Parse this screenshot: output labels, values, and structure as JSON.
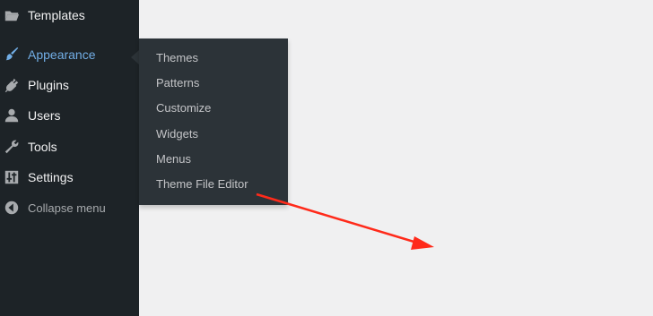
{
  "sidebar": {
    "items": [
      {
        "label": "Templates",
        "icon": "folder-icon"
      },
      {
        "label": "Appearance",
        "icon": "paintbrush-icon",
        "active": true
      },
      {
        "label": "Plugins",
        "icon": "plug-icon"
      },
      {
        "label": "Users",
        "icon": "user-icon"
      },
      {
        "label": "Tools",
        "icon": "wrench-icon"
      },
      {
        "label": "Settings",
        "icon": "settings-sliders-icon"
      },
      {
        "label": "Collapse menu",
        "icon": "collapse-arrow-icon"
      }
    ]
  },
  "submenu": {
    "items": [
      {
        "label": "Themes"
      },
      {
        "label": "Patterns"
      },
      {
        "label": "Customize"
      },
      {
        "label": "Widgets"
      },
      {
        "label": "Menus"
      },
      {
        "label": "Theme File Editor"
      }
    ]
  },
  "annotation": {
    "arrow_color": "#ff2a1a",
    "description_icon": "red-arrow-icon"
  },
  "colors": {
    "sidebar_bg": "#1d2327",
    "submenu_bg": "#2c3338",
    "active_text": "#72aee6",
    "page_bg": "#f0f0f1"
  }
}
